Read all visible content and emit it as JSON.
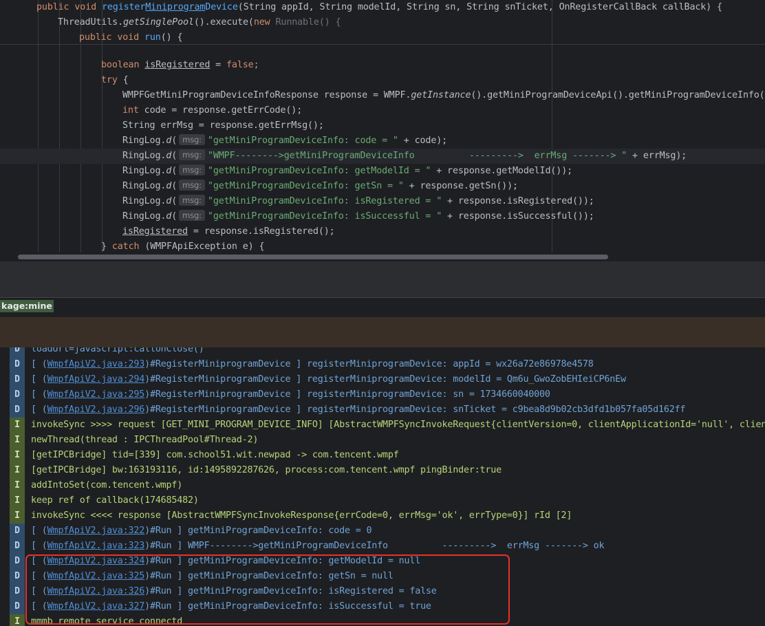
{
  "editor": {
    "lines": [
      {
        "id": "l1",
        "parts": [
          [
            "kw",
            "public void "
          ],
          [
            "fn",
            "register"
          ],
          [
            "fn field",
            "Miniprogram"
          ],
          [
            "fn",
            "Device"
          ],
          [
            "lam",
            "(String appId, String modelId, String sn, String snTicket, OnRegisterCallBack callBack) {"
          ]
        ]
      },
      {
        "id": "l2",
        "parts": [
          [
            "lam",
            "ThreadUtils."
          ],
          [
            "ital",
            "getSinglePool"
          ],
          [
            "lam",
            "().execute("
          ],
          [
            "kw",
            "new "
          ],
          [
            "dim",
            "Runnable() {"
          ]
        ]
      },
      {
        "id": "l3",
        "parts": [
          [
            "kw",
            "public void "
          ],
          [
            "fn",
            "run"
          ],
          [
            "lam",
            "() {"
          ]
        ]
      },
      {
        "id": "l4",
        "parts": [
          [
            "kw",
            "boolean "
          ],
          [
            "field",
            "isRegistered"
          ],
          [
            "lam",
            " = "
          ],
          [
            "kw",
            "false"
          ],
          [
            "kw",
            ";"
          ]
        ]
      },
      {
        "id": "l5",
        "parts": [
          [
            "kw",
            "try "
          ],
          [
            "lam",
            "{"
          ]
        ]
      },
      {
        "id": "l6",
        "parts": [
          [
            "lam",
            "WMPFGetMiniProgramDeviceInfoResponse response = WMPF."
          ],
          [
            "ital",
            "getInstance"
          ],
          [
            "lam",
            "().getMiniProgramDeviceApi().getMiniProgramDeviceInfo();"
          ]
        ]
      },
      {
        "id": "l7",
        "parts": [
          [
            "kw",
            "int "
          ],
          [
            "lam",
            "code = response.getErrCode();"
          ]
        ]
      },
      {
        "id": "l8",
        "parts": [
          [
            "lam",
            "String errMsg = response.getErrMsg();"
          ]
        ]
      },
      {
        "id": "l9",
        "parts": [
          [
            "lam",
            "RingLog."
          ],
          [
            "ital",
            "d"
          ],
          [
            "lam",
            "("
          ],
          [
            "hint",
            "msg:"
          ],
          [
            "st",
            "\"getMiniProgramDeviceInfo: code = \""
          ],
          [
            "lam",
            " + code);"
          ]
        ]
      },
      {
        "id": "l10",
        "parts": [
          [
            "lam",
            "RingLog."
          ],
          [
            "ital",
            "d"
          ],
          [
            "lam",
            "("
          ],
          [
            "hint",
            "msg:"
          ],
          [
            "st",
            "\"WMPF-------->getMiniProgramDeviceInfo          --------->  errMsg -------> \""
          ],
          [
            "lam",
            " + errMsg);"
          ]
        ]
      },
      {
        "id": "l11",
        "parts": [
          [
            "lam",
            "RingLog."
          ],
          [
            "ital",
            "d"
          ],
          [
            "lam",
            "("
          ],
          [
            "hint",
            "msg:"
          ],
          [
            "st",
            "\"getMiniProgramDeviceInfo: getModelId = \""
          ],
          [
            "lam",
            " + response.getModelId());"
          ]
        ]
      },
      {
        "id": "l12",
        "parts": [
          [
            "lam",
            "RingLog."
          ],
          [
            "ital",
            "d"
          ],
          [
            "lam",
            "("
          ],
          [
            "hint",
            "msg:"
          ],
          [
            "st",
            "\"getMiniProgramDeviceInfo: getSn = \""
          ],
          [
            "lam",
            " + response.getSn());"
          ]
        ]
      },
      {
        "id": "l13",
        "parts": [
          [
            "lam",
            "RingLog."
          ],
          [
            "ital",
            "d"
          ],
          [
            "lam",
            "("
          ],
          [
            "hint",
            "msg:"
          ],
          [
            "st",
            "\"getMiniProgramDeviceInfo: isRegistered = \""
          ],
          [
            "lam",
            " + response.isRegistered());"
          ]
        ]
      },
      {
        "id": "l14",
        "parts": [
          [
            "lam",
            "RingLog."
          ],
          [
            "ital",
            "d"
          ],
          [
            "lam",
            "("
          ],
          [
            "hint",
            "msg:"
          ],
          [
            "st",
            "\"getMiniProgramDeviceInfo: isSuccessful = \""
          ],
          [
            "lam",
            " + response.isSuccessful());"
          ]
        ]
      },
      {
        "id": "l15",
        "parts": [
          [
            "field",
            "isRegistered"
          ],
          [
            "lam",
            " = response.isRegistered();"
          ]
        ]
      },
      {
        "id": "l16",
        "parts": [
          [
            "lam",
            "} "
          ],
          [
            "kw",
            "catch "
          ],
          [
            "lam",
            "(WMPFApiException e) {"
          ]
        ]
      }
    ]
  },
  "filter": {
    "text": "kage:mine"
  },
  "log": {
    "rows": [
      {
        "level": "D",
        "text": "loadUrl=javascript:callonClose()"
      },
      {
        "level": "D",
        "pre": "[ (",
        "link": "WmpfApiV2.java:293",
        "post": ")#RegisterMiniprogramDevice ] registerMiniprogramDevice: appId = wx26a72e86978e4578"
      },
      {
        "level": "D",
        "pre": "[ (",
        "link": "WmpfApiV2.java:294",
        "post": ")#RegisterMiniprogramDevice ] registerMiniprogramDevice: modelId = Qm6u_GwoZobEHIeiCP6nEw"
      },
      {
        "level": "D",
        "pre": "[ (",
        "link": "WmpfApiV2.java:295",
        "post": ")#RegisterMiniprogramDevice ] registerMiniprogramDevice: sn = 1734660040000"
      },
      {
        "level": "D",
        "pre": "[ (",
        "link": "WmpfApiV2.java:296",
        "post": ")#RegisterMiniprogramDevice ] registerMiniprogramDevice: snTicket = c9bea8d9b02cb3dfd1b057fa05d162ff"
      },
      {
        "level": "I",
        "text": "invokeSync >>>> request [GET_MINI_PROGRAM_DEVICE_INFO] [AbstractWMPFSyncInvokeRequest{clientVersion=0, clientApplicationId='null', client"
      },
      {
        "level": "I",
        "text": "newThread(thread : IPCThreadPool#Thread-2)"
      },
      {
        "level": "I",
        "text": "[getIPCBridge] tid=[339] com.school51.wit.newpad -> com.tencent.wmpf"
      },
      {
        "level": "I",
        "text": "[getIPCBridge] bw:163193116, id:1495892287626, process:com.tencent.wmpf pingBinder:true"
      },
      {
        "level": "I",
        "text": "addIntoSet(com.tencent.wmpf)"
      },
      {
        "level": "I",
        "text": "keep ref of callback(174685482)"
      },
      {
        "level": "I",
        "text": "invokeSync <<<< response [AbstractWMPFSyncInvokeResponse{errCode=0, errMsg='ok', errType=0}] rId [2]"
      },
      {
        "level": "D",
        "pre": "[ (",
        "link": "WmpfApiV2.java:322",
        "post": ")#Run ] getMiniProgramDeviceInfo: code = 0"
      },
      {
        "level": "D",
        "pre": "[ (",
        "link": "WmpfApiV2.java:323",
        "post": ")#Run ] WMPF-------->getMiniProgramDeviceInfo          --------->  errMsg -------> ok"
      },
      {
        "level": "D",
        "pre": "[ (",
        "link": "WmpfApiV2.java:324",
        "post": ")#Run ] getMiniProgramDeviceInfo: getModelId = null"
      },
      {
        "level": "D",
        "pre": "[ (",
        "link": "WmpfApiV2.java:325",
        "post": ")#Run ] getMiniProgramDeviceInfo: getSn = null"
      },
      {
        "level": "D",
        "pre": "[ (",
        "link": "WmpfApiV2.java:326",
        "post": ")#Run ] getMiniProgramDeviceInfo: isRegistered = false"
      },
      {
        "level": "D",
        "pre": "[ (",
        "link": "WmpfApiV2.java:327",
        "post": ")#Run ] getMiniProgramDeviceInfo: isSuccessful = true"
      },
      {
        "level": "I",
        "text": "mmmb remote service connectd"
      }
    ]
  }
}
